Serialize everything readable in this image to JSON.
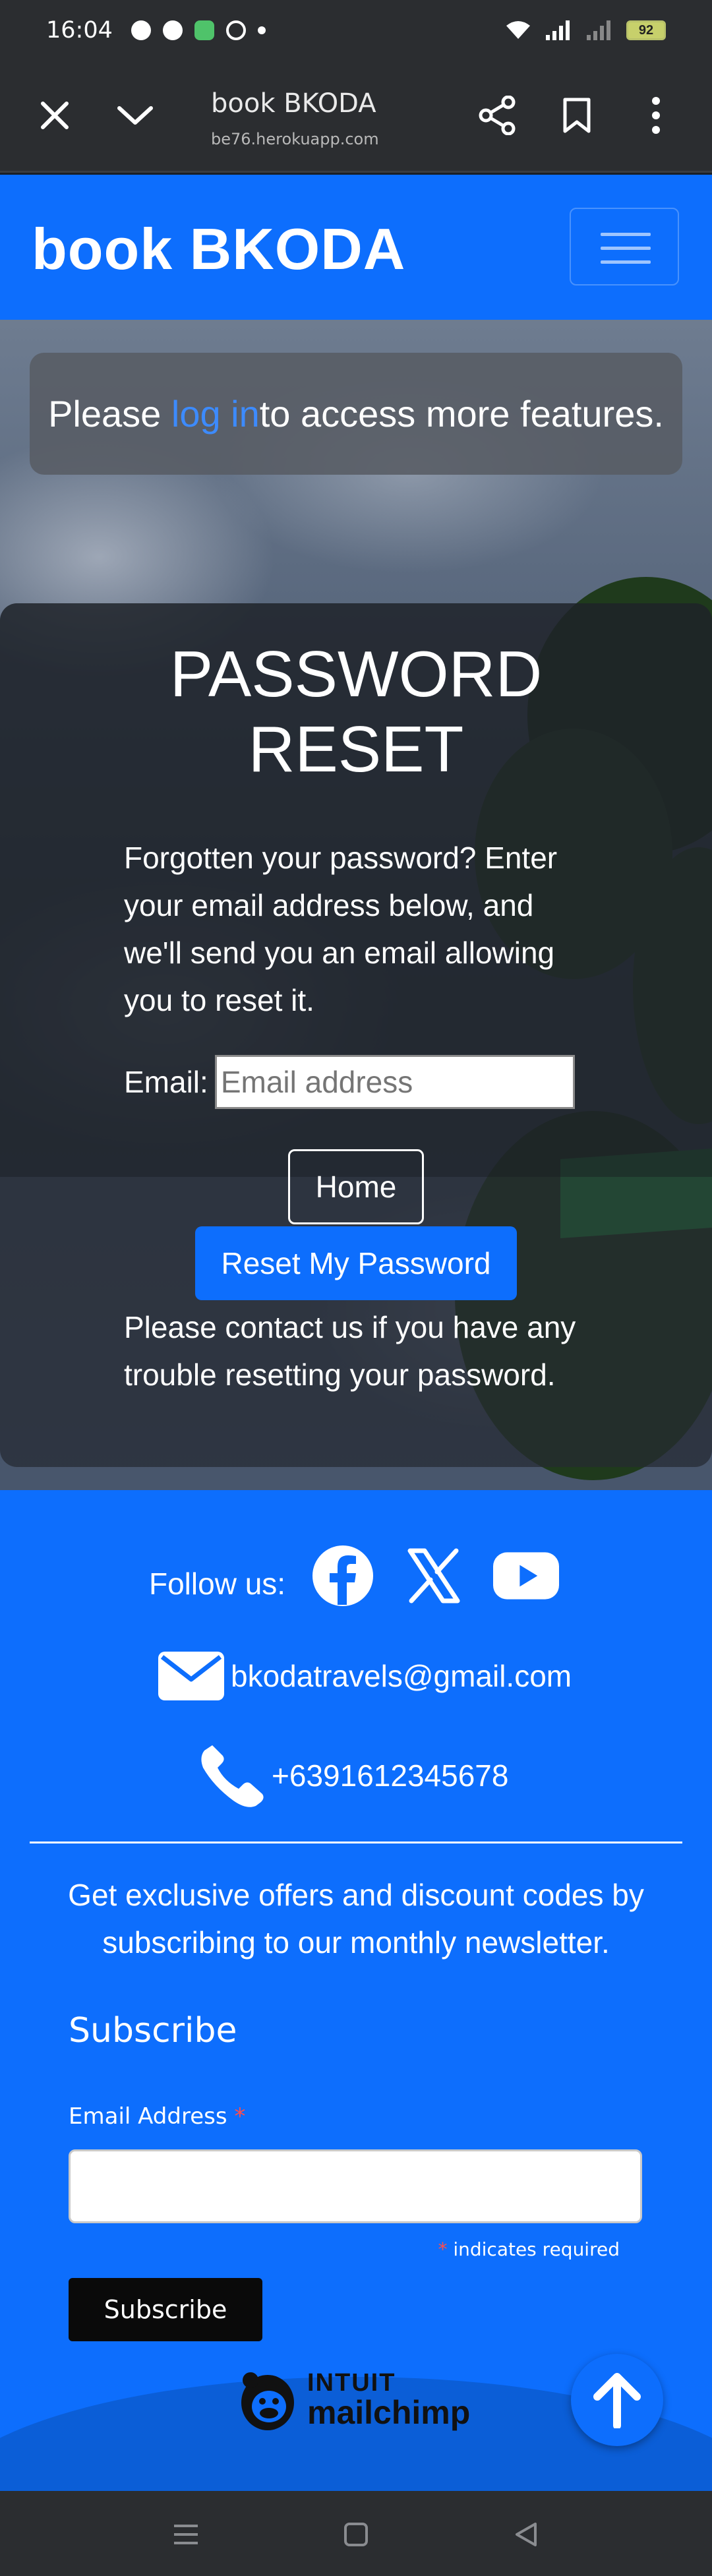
{
  "status_bar": {
    "time": "16:04",
    "battery": "92",
    "icons": [
      "facebook-icon",
      "messenger-icon",
      "message-icon",
      "g-icon",
      "dot-icon",
      "wifi-icon",
      "signal-icon",
      "signal-no-icon",
      "battery-icon"
    ]
  },
  "browser": {
    "title": "book BKODA",
    "url": "be76.herokuapp.com"
  },
  "navbar": {
    "brand": "book BKODA"
  },
  "alert": {
    "before": "Please ",
    "link": "log in",
    "after": " to access more features."
  },
  "reset_card": {
    "title": "PASSWORD RESET",
    "intro": "Forgotten your password? Enter your email address below, and we'll send you an email allowing you to reset it.",
    "email_label": "Email:",
    "email_placeholder": "Email address",
    "home_button": "Home",
    "reset_button": "Reset My Password",
    "contact_text": "Please contact us if you have any trouble resetting your password."
  },
  "footer": {
    "follow_label": "Follow us:",
    "email": "bkodatravels@gmail.com",
    "phone": "+6391612345678",
    "newsletter_text": "Get exclusive offers and discount codes by subscribing to our monthly newsletter.",
    "subscribe_heading": "Subscribe",
    "email_field_label": "Email Address",
    "required_marker": "*",
    "required_note": "indicates required",
    "subscribe_button": "Subscribe",
    "mailchimp_top": "INTUIT",
    "mailchimp_bottom": "mailchimp"
  },
  "colors": {
    "primary": "#0d6efd",
    "link": "#3d8bfd",
    "required": "#ff4d4d"
  }
}
